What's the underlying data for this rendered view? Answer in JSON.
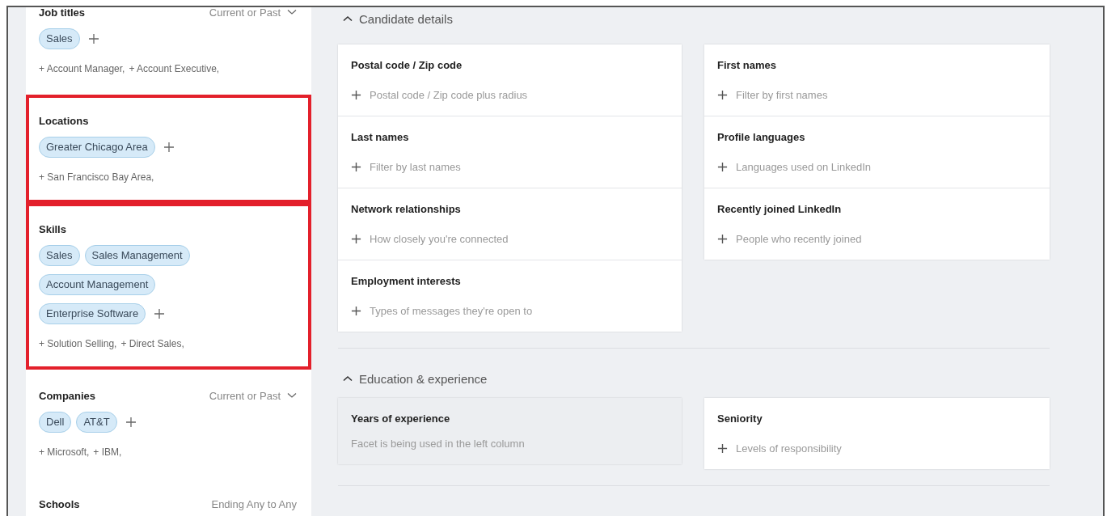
{
  "facets": [
    {
      "title": "Job titles",
      "highlighted": false,
      "qualifier": {
        "label": "Current or Past",
        "caret": true
      },
      "chips": [
        "Sales"
      ],
      "suggestions": [
        "+ Account Manager,",
        "+ Account Executive,"
      ]
    },
    {
      "title": "Locations",
      "highlighted": true,
      "chips": [
        "Greater Chicago Area"
      ],
      "suggestions": [
        "+ San Francisco Bay Area,"
      ]
    },
    {
      "title": "Skills",
      "highlighted": true,
      "chips": [
        "Sales",
        "Sales Management",
        "Account Management",
        "Enterprise Software"
      ],
      "suggestions": [
        "+ Solution Selling,",
        "+ Direct Sales,"
      ]
    },
    {
      "title": "Companies",
      "highlighted": false,
      "qualifier": {
        "label": "Current or Past",
        "caret": true
      },
      "chips": [
        "Dell",
        "AT&T"
      ],
      "suggestions": [
        "+ Microsoft,",
        "+ IBM,"
      ]
    },
    {
      "title": "Schools",
      "highlighted": false,
      "qualifier": {
        "label": "Ending Any to Any",
        "caret": false
      }
    }
  ],
  "sections": [
    {
      "title": "Candidate details",
      "expanded": true,
      "cards": [
        [
          {
            "title": "Postal code / Zip code",
            "hint": "Postal code / Zip code plus radius",
            "disabled": false
          },
          {
            "title": "Last names",
            "hint": "Filter by last names",
            "disabled": false
          },
          {
            "title": "Network relationships",
            "hint": "How closely you're connected",
            "disabled": false
          },
          {
            "title": "Employment interests",
            "hint": "Types of messages they're open to",
            "disabled": false
          }
        ],
        [
          {
            "title": "First names",
            "hint": "Filter by first names",
            "disabled": false
          },
          {
            "title": "Profile languages",
            "hint": "Languages used on LinkedIn",
            "disabled": false
          },
          {
            "title": "Recently joined LinkedIn",
            "hint": "People who recently joined",
            "disabled": false
          }
        ]
      ]
    },
    {
      "title": "Education & experience",
      "expanded": true,
      "cards": [
        [
          {
            "title": "Years of experience",
            "hint": "Facet is being used in the left column",
            "disabled": true
          }
        ],
        [
          {
            "title": "Seniority",
            "hint": "Levels of responsibility",
            "disabled": false
          }
        ]
      ]
    }
  ]
}
